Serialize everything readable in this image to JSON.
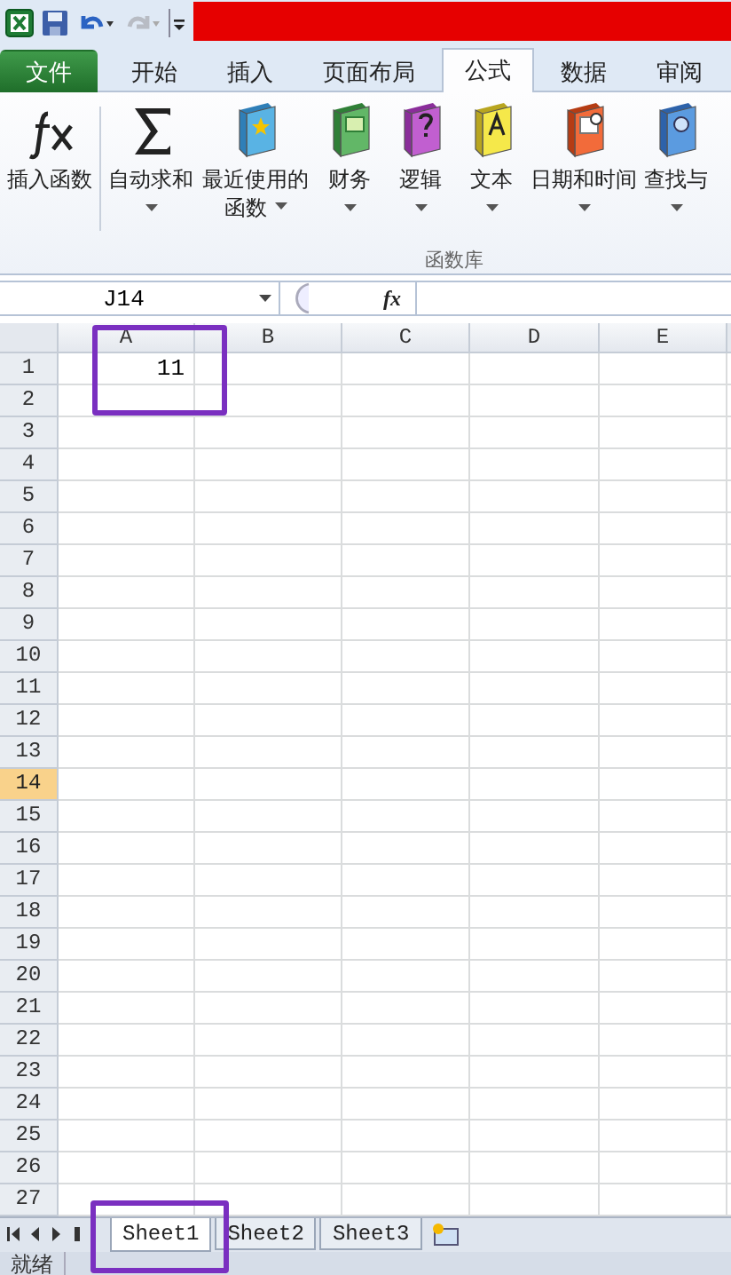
{
  "quick_access": {
    "buttons": [
      {
        "kind": "app"
      },
      {
        "kind": "save"
      },
      {
        "kind": "undo",
        "disabled": false
      },
      {
        "kind": "redo",
        "disabled": true
      },
      {
        "kind": "customize"
      }
    ]
  },
  "ribbon_tabs": [
    {
      "label": "文件",
      "kind": "file",
      "selected": false
    },
    {
      "label": "开始",
      "kind": "tab",
      "selected": false
    },
    {
      "label": "插入",
      "kind": "tab",
      "selected": false
    },
    {
      "label": "页面布局",
      "kind": "tab",
      "selected": false
    },
    {
      "label": "公式",
      "kind": "tab",
      "selected": true
    },
    {
      "label": "数据",
      "kind": "tab",
      "selected": false
    },
    {
      "label": "审阅",
      "kind": "tab",
      "selected": false
    }
  ],
  "ribbon": {
    "group_label": "函数库",
    "buttons": [
      {
        "label": "插入函数",
        "kind": "fx",
        "dropdown": false
      },
      {
        "label": "自动求和",
        "kind": "sum",
        "dropdown": true
      },
      {
        "label": "最近使用的函数",
        "kind": "recent",
        "dropdown": true
      },
      {
        "label": "财务",
        "kind": "finance",
        "dropdown": true
      },
      {
        "label": "逻辑",
        "kind": "logic",
        "dropdown": true
      },
      {
        "label": "文本",
        "kind": "text",
        "dropdown": true
      },
      {
        "label": "日期和时间",
        "kind": "date",
        "dropdown": true
      },
      {
        "label": "查找与",
        "kind": "lookup",
        "dropdown": true
      }
    ]
  },
  "formula_bar": {
    "name_box": "J14",
    "fx": "fx"
  },
  "grid": {
    "columns": [
      {
        "label": "A"
      },
      {
        "label": "B"
      },
      {
        "label": "C"
      },
      {
        "label": "D"
      },
      {
        "label": "E"
      }
    ],
    "rows": [
      {
        "label": "1",
        "selected": false,
        "cells": {
          "A": "11"
        }
      },
      {
        "label": "2",
        "selected": false
      },
      {
        "label": "3",
        "selected": false
      },
      {
        "label": "4",
        "selected": false
      },
      {
        "label": "5",
        "selected": false
      },
      {
        "label": "6",
        "selected": false
      },
      {
        "label": "7",
        "selected": false
      },
      {
        "label": "8",
        "selected": false
      },
      {
        "label": "9",
        "selected": false
      },
      {
        "label": "10",
        "selected": false
      },
      {
        "label": "11",
        "selected": false
      },
      {
        "label": "12",
        "selected": false
      },
      {
        "label": "13",
        "selected": false
      },
      {
        "label": "14",
        "selected": true
      },
      {
        "label": "15",
        "selected": false
      },
      {
        "label": "16",
        "selected": false
      },
      {
        "label": "17",
        "selected": false
      },
      {
        "label": "18",
        "selected": false
      },
      {
        "label": "19",
        "selected": false
      },
      {
        "label": "20",
        "selected": false
      },
      {
        "label": "21",
        "selected": false
      },
      {
        "label": "22",
        "selected": false
      },
      {
        "label": "23",
        "selected": false
      },
      {
        "label": "24",
        "selected": false
      },
      {
        "label": "25",
        "selected": false
      },
      {
        "label": "26",
        "selected": false
      },
      {
        "label": "27",
        "selected": false
      }
    ]
  },
  "sheet_tabs": [
    {
      "label": "Sheet1",
      "selected": true
    },
    {
      "label": "Sheet2",
      "selected": false
    },
    {
      "label": "Sheet3",
      "selected": false
    }
  ],
  "status_bar": {
    "text": "就绪"
  },
  "annotations": {
    "cell_range": {
      "color": "#7a2fc0"
    },
    "sheet_tab": {
      "color": "#7a2fc0"
    }
  }
}
